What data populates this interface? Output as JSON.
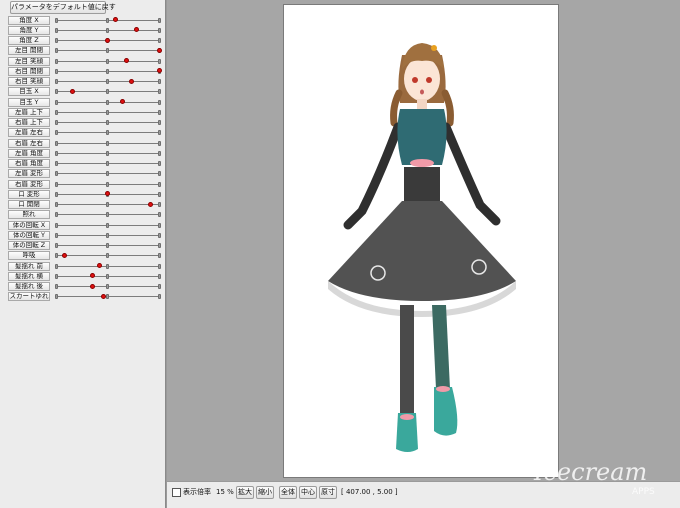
{
  "panel": {
    "reset_button": "パラメータをデフォルト値に戻す",
    "params": [
      {
        "label": "角度 X",
        "value": 0.58
      },
      {
        "label": "角度 Y",
        "value": 0.78
      },
      {
        "label": "角度 Z",
        "value": 0.5
      },
      {
        "label": "左目 開閉",
        "value": 1.0
      },
      {
        "label": "左目 笑顔",
        "value": 0.68
      },
      {
        "label": "右目 開閉",
        "value": 1.0
      },
      {
        "label": "右目 笑顔",
        "value": 0.73
      },
      {
        "label": "目玉 X",
        "value": 0.16
      },
      {
        "label": "目玉 Y",
        "value": 0.65
      },
      {
        "label": "左眉 上下",
        "value": null
      },
      {
        "label": "右眉 上下",
        "value": null
      },
      {
        "label": "左眉 左右",
        "value": null
      },
      {
        "label": "右眉 左右",
        "value": null
      },
      {
        "label": "左眉 角度",
        "value": null
      },
      {
        "label": "右眉 角度",
        "value": null
      },
      {
        "label": "左眉 変形",
        "value": null
      },
      {
        "label": "右眉 変形",
        "value": null
      },
      {
        "label": "口 変形",
        "value": 0.5
      },
      {
        "label": "口 開閉",
        "value": 0.92
      },
      {
        "label": "照れ",
        "value": null
      },
      {
        "label": "体の回転 X",
        "value": null
      },
      {
        "label": "体の回転 Y",
        "value": null
      },
      {
        "label": "体の回転 Z",
        "value": null
      },
      {
        "label": "呼吸",
        "value": 0.08
      },
      {
        "label": "髪揺れ 前",
        "value": 0.42
      },
      {
        "label": "髪揺れ 横",
        "value": 0.35
      },
      {
        "label": "髪揺れ 後",
        "value": 0.35
      },
      {
        "label": "スカートゆれ",
        "value": 0.46
      }
    ]
  },
  "toolbar": {
    "show_zoom_label": "表示倍率",
    "zoom_value": "15 %",
    "zoom_in": "拡大",
    "zoom_out": "縮小",
    "fit_all": "全体",
    "center": "中心",
    "actual_size": "原寸",
    "coords": "[ 407.00 ,   5.00 ]"
  },
  "watermark": {
    "brand": "Icecream",
    "sub": "APPS"
  },
  "colors": {
    "knob": "#e01010",
    "panel_bg": "#ececec",
    "canvas_bg": "#a6a6a6",
    "paper": "#ffffff"
  }
}
